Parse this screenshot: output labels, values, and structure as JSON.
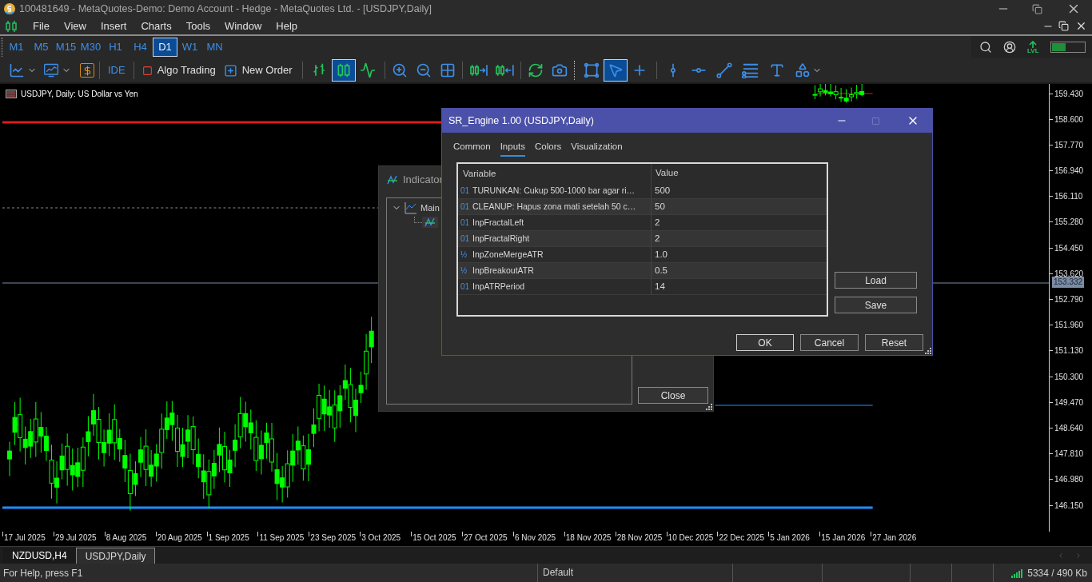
{
  "window": {
    "title": "100481649 - MetaQuotes-Demo: Demo Account - Hedge - MetaQuotes Ltd. - [USDJPY,Daily]"
  },
  "menu": [
    "File",
    "View",
    "Insert",
    "Charts",
    "Tools",
    "Window",
    "Help"
  ],
  "timeframes": [
    {
      "label": "M1",
      "selected": false
    },
    {
      "label": "M5",
      "selected": false
    },
    {
      "label": "M15",
      "selected": false
    },
    {
      "label": "M30",
      "selected": false
    },
    {
      "label": "H1",
      "selected": false
    },
    {
      "label": "H4",
      "selected": false
    },
    {
      "label": "D1",
      "selected": true
    },
    {
      "label": "W1",
      "selected": false
    },
    {
      "label": "MN",
      "selected": false
    }
  ],
  "level_badge": "LVL",
  "toolbar": {
    "ide": "IDE",
    "algo_trading": "Algo Trading",
    "new_order": "New Order"
  },
  "chart_types": [
    {
      "kind": "bars",
      "selected": false
    },
    {
      "kind": "candles",
      "selected": true
    },
    {
      "kind": "line",
      "selected": false
    }
  ],
  "cursor_modes": [
    {
      "kind": "frame",
      "selected": false
    },
    {
      "kind": "cursor",
      "selected": true
    },
    {
      "kind": "crosshair",
      "selected": false
    }
  ],
  "chart": {
    "symbol_label": "USDJPY, Daily:  US Dollar vs Yen",
    "bid_price": "153.332",
    "price_axis": [
      "159.430",
      "158.600",
      "157.770",
      "156.940",
      "156.110",
      "155.280",
      "154.450",
      "153.620",
      "152.790",
      "151.960",
      "151.130",
      "150.300",
      "149.470",
      "148.640",
      "147.810",
      "146.980",
      "146.150"
    ],
    "date_axis": [
      "17 Jul 2025",
      "29 Jul 2025",
      "8 Aug 2025",
      "20 Aug 2025",
      "1 Sep 2025",
      "11 Sep 2025",
      "23 Sep 2025",
      "3 Oct 2025",
      "15 Oct 2025",
      "27 Oct 2025",
      "6 Nov 2025",
      "18 Nov 2025",
      "28 Nov 2025",
      "10 Dec 2025",
      "22 Dec 2025",
      "5 Jan 2026",
      "15 Jan 2026",
      "27 Jan 2026"
    ]
  },
  "indicators_dialog": {
    "title": "Indicator",
    "tree_root": "Main",
    "close": "Close"
  },
  "dialog": {
    "title": "SR_Engine 1.00 (USDJPY,Daily)",
    "tabs": [
      {
        "label": "Common",
        "selected": false
      },
      {
        "label": "Inputs",
        "selected": true
      },
      {
        "label": "Colors",
        "selected": false
      },
      {
        "label": "Visualization",
        "selected": false
      }
    ],
    "columns": [
      "Variable",
      "Value"
    ],
    "rows": [
      {
        "type_mark": "01",
        "variable": "TURUNKAN: Cukup 500-1000 bar agar ri…",
        "value": "500"
      },
      {
        "type_mark": "01",
        "variable": "CLEANUP: Hapus zona mati setelah 50 c…",
        "value": "50"
      },
      {
        "type_mark": "01",
        "variable": "InpFractalLeft",
        "value": "2"
      },
      {
        "type_mark": "01",
        "variable": "InpFractalRight",
        "value": "2"
      },
      {
        "type_mark": "½",
        "variable": "InpZoneMergeATR",
        "value": "1.0"
      },
      {
        "type_mark": "½",
        "variable": "InpBreakoutATR",
        "value": "0.5"
      },
      {
        "type_mark": "01",
        "variable": "InpATRPeriod",
        "value": "14"
      }
    ],
    "side_buttons": [
      "Load",
      "Save"
    ],
    "buttons": [
      "OK",
      "Cancel",
      "Reset"
    ]
  },
  "chart_tabs": [
    {
      "label": "NZDUSD,H4",
      "selected": false
    },
    {
      "label": "USDJPY,Daily",
      "selected": true
    }
  ],
  "status_bar": {
    "help": "For Help, press F1",
    "profile": "Default",
    "traffic": "5334 / 490 Kb"
  }
}
